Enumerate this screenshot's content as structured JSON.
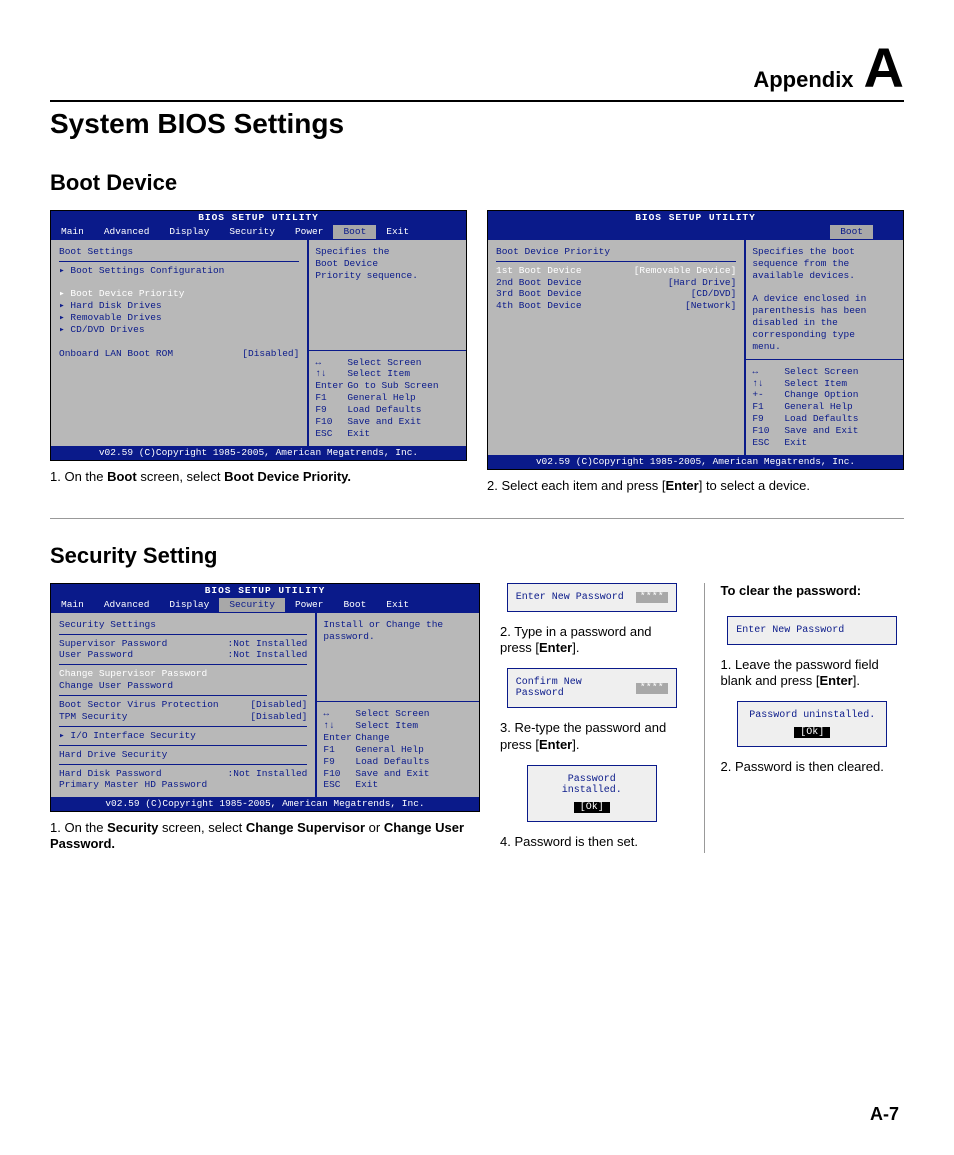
{
  "header": {
    "appendix_label": "Appendix",
    "letter": "A"
  },
  "page_title": "System BIOS Settings",
  "page_num": "A-7",
  "sec_boot": {
    "heading": "Boot Device",
    "bios_title": "BIOS SETUP UTILITY",
    "menu": [
      "Main",
      "Advanced",
      "Display",
      "Security",
      "Power",
      "Boot",
      "Exit"
    ],
    "footer": "v02.59 (C)Copyright 1985-2005, American Megatrends, Inc.",
    "left1": {
      "section": "Boot Settings",
      "items": [
        "▸ Boot Settings Configuration",
        "",
        "▸ Boot Device Priority",
        "▸ Hard Disk Drives",
        "▸ Removable Drives",
        "▸ CD/DVD Drives"
      ],
      "lan_label": "Onboard LAN Boot ROM",
      "lan_value": "[Disabled]"
    },
    "right1_top": "Specifies the\nBoot Device\nPriority sequence.",
    "nav1": [
      [
        "↔",
        "Select Screen"
      ],
      [
        "↑↓",
        "Select Item"
      ],
      [
        "Enter",
        "Go to Sub Screen"
      ],
      [
        "F1",
        "General Help"
      ],
      [
        "F9",
        "Load Defaults"
      ],
      [
        "F10",
        "Save and Exit"
      ],
      [
        "ESC",
        "Exit"
      ]
    ],
    "caption1_pre": "1. On the ",
    "caption1_b1": "Boot",
    "caption1_mid": " screen, select ",
    "caption1_b2": "Boot Device Priority.",
    "left2": {
      "section": "Boot Device Priority",
      "rows": [
        [
          "1st Boot Device",
          "[Removable Device]",
          true
        ],
        [
          "2nd Boot Device",
          "[Hard Drive]",
          false
        ],
        [
          "3rd Boot Device",
          "[CD/DVD]",
          false
        ],
        [
          "4th Boot Device",
          "[Network]",
          false
        ]
      ]
    },
    "right2_top": "Specifies the boot\nsequence from the\navailable devices.\n\nA device enclosed in\nparenthesis has been\ndisabled in the\ncorresponding type\nmenu.",
    "nav2": [
      [
        "↔",
        "Select Screen"
      ],
      [
        "↑↓",
        "Select Item"
      ],
      [
        "+-",
        "Change Option"
      ],
      [
        "F1",
        "General Help"
      ],
      [
        "F9",
        "Load Defaults"
      ],
      [
        "F10",
        "Save and Exit"
      ],
      [
        "ESC",
        "Exit"
      ]
    ],
    "caption2_pre": "2. Select each item and press [",
    "caption2_b": "Enter",
    "caption2_post": "] to select a device."
  },
  "sec_security": {
    "heading": "Security Setting",
    "left": {
      "section": "Security Settings",
      "rows1": [
        [
          "Supervisor Password",
          ":Not Installed"
        ],
        [
          "User Password",
          ":Not Installed"
        ]
      ],
      "hl1": "Change Supervisor Password",
      "row2": "Change User Password",
      "rows3": [
        [
          "Boot Sector Virus Protection",
          "[Disabled]"
        ],
        [
          "TPM Security",
          "[Disabled]"
        ]
      ],
      "io": "▸ I/O Interface Security",
      "hd_section": "Hard Drive Security",
      "rows4": [
        [
          "Hard Disk Password",
          ":Not Installed"
        ],
        [
          "Primary Master HD Password",
          ""
        ]
      ]
    },
    "right_top": "Install or Change the\npassword.",
    "nav3": [
      [
        "↔",
        "Select Screen"
      ],
      [
        "↑↓",
        "Select Item"
      ],
      [
        "Enter",
        "Change"
      ],
      [
        "F1",
        "General Help"
      ],
      [
        "F9",
        "Load Defaults"
      ],
      [
        "F10",
        "Save and Exit"
      ],
      [
        "ESC",
        "Exit"
      ]
    ],
    "caption_pre": "1. On the ",
    "caption_b1": "Security",
    "caption_mid": " screen, select ",
    "caption_b2": "Change Supervisor",
    "caption_or": " or ",
    "caption_b3": "Change User Password.",
    "mid": {
      "box1": "Enter New Password",
      "box1_val": "****",
      "step2_pre": "2. Type in a password and press [",
      "step2_b": "Enter",
      "step2_post": "].",
      "box2": "Confirm New Password",
      "box2_val": "****",
      "step3_pre": "3. Re-type the password and press [",
      "step3_b": "Enter",
      "step3_post": "].",
      "box3": "Password installed.",
      "ok": "[Ok]",
      "step4": "4. Password is then set."
    },
    "right": {
      "hd": "To clear the password:",
      "box1": "Enter New Password",
      "box1_val": "    ",
      "step1_pre": "1. Leave the password field blank and press [",
      "step1_b": "Enter",
      "step1_post": "].",
      "box2": "Password uninstalled.",
      "ok": "[Ok]",
      "step2": "2. Password is then cleared."
    }
  }
}
